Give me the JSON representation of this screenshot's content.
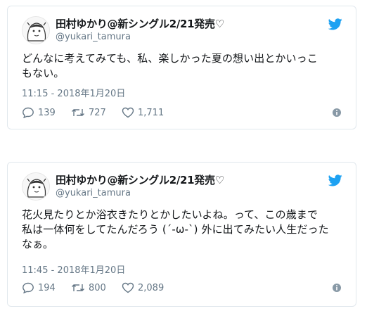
{
  "tweets": [
    {
      "display_name": "田村ゆかり@新シングル2/21発売♡",
      "handle": "@yukari_tamura",
      "text_lines": [
        "どんなに考えてみても、私、楽しかった夏の想い出とかいっこ",
        "もない。"
      ],
      "timestamp": "11:15 - 2018年1月20日",
      "replies": "139",
      "retweets": "727",
      "likes": "1,711"
    },
    {
      "display_name": "田村ゆかり@新シングル2/21発売♡",
      "handle": "@yukari_tamura",
      "text_lines": [
        "花火見たりとか浴衣きたりとかしたいよね。って、この歳まで",
        "私は一体何をしてたんだろう (´-ω-`) 外に出てみたい人生だった",
        "なぁ。"
      ],
      "timestamp": "11:45 - 2018年1月20日",
      "replies": "194",
      "retweets": "800",
      "likes": "2,089"
    }
  ],
  "colors": {
    "twitter_blue": "#1da1f2",
    "muted": "#657786",
    "border": "#e1e8ed"
  },
  "icons": {
    "brand": "twitter-bird-icon",
    "reply": "reply-icon",
    "retweet": "retweet-icon",
    "like": "heart-icon",
    "info": "info-icon"
  }
}
